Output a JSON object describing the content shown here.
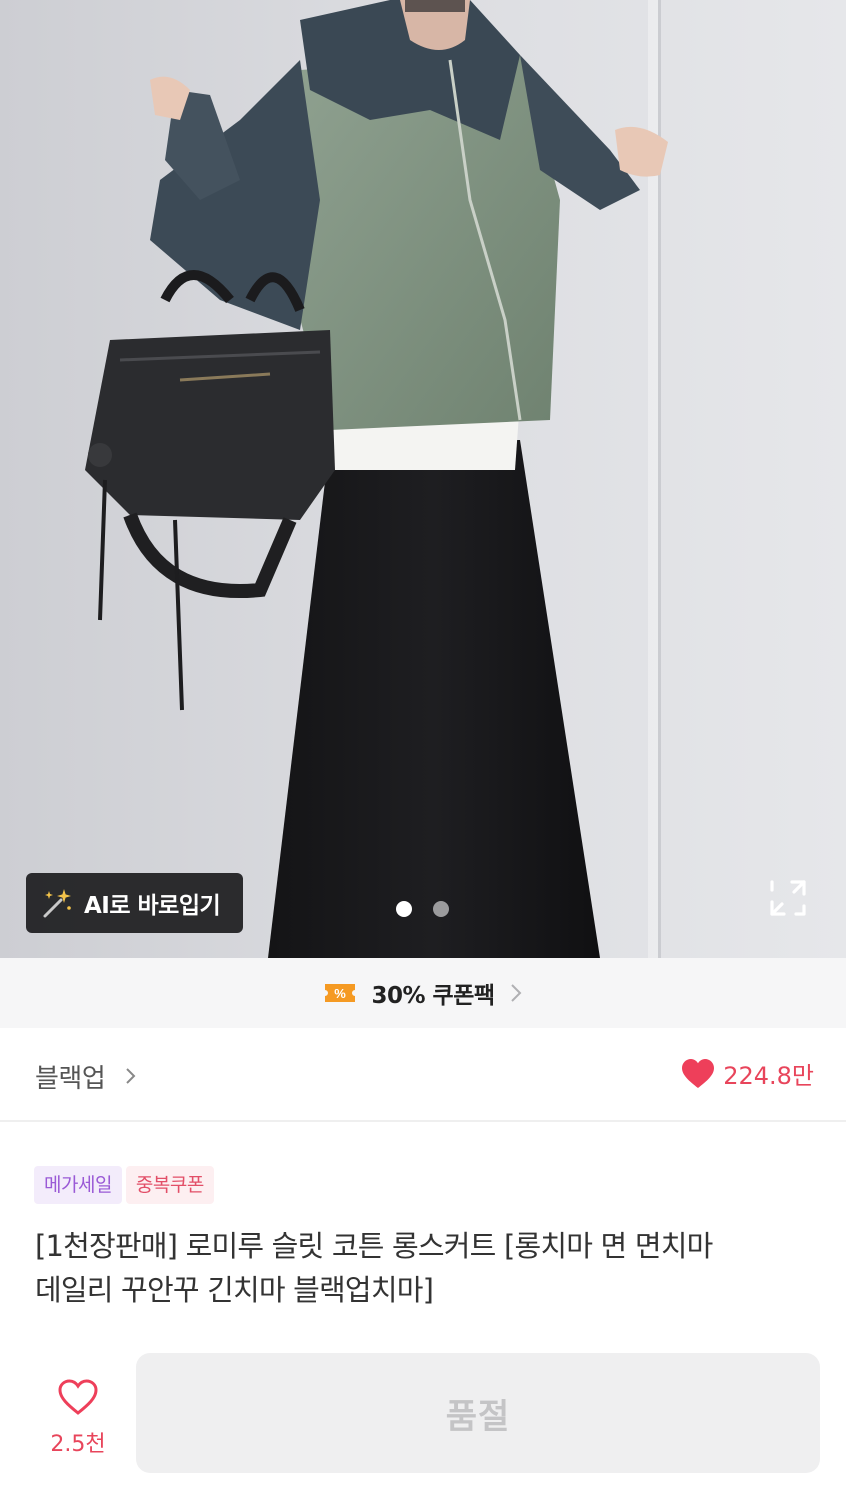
{
  "hero": {
    "ai_button_label": "AI로 바로입기",
    "ai_icon": "magic-wand-icon",
    "slide_dots": [
      {
        "active": true
      },
      {
        "active": false
      }
    ],
    "expand_icon": "expand-icon"
  },
  "coupon": {
    "icon": "coupon-ticket-icon",
    "label": "30% 쿠폰팩",
    "chevron": "chevron-right-icon"
  },
  "store": {
    "name": "블랙업",
    "chevron": "chevron-right-icon",
    "like_icon": "heart-filled-icon",
    "like_count": "224.8만"
  },
  "product": {
    "badges": [
      {
        "label": "메가세일",
        "color": "#9a5ad6"
      },
      {
        "label": "중복쿠폰",
        "color": "#e24f68"
      }
    ],
    "title_line1": "[1천장판매] 로미루 슬릿 코튼 롱스커트 [롱치마 면 면치마",
    "title_line2": "데일리 꾸안꾸 긴치마 블랙업치마]"
  },
  "bottom_bar": {
    "wish_icon": "heart-outline-icon",
    "wish_count": "2.5천",
    "soldout_label": "품절"
  },
  "colors": {
    "accent_pink": "#e8455b",
    "coupon_orange": "#f59a23",
    "soldout_text": "#c4c4c6"
  }
}
